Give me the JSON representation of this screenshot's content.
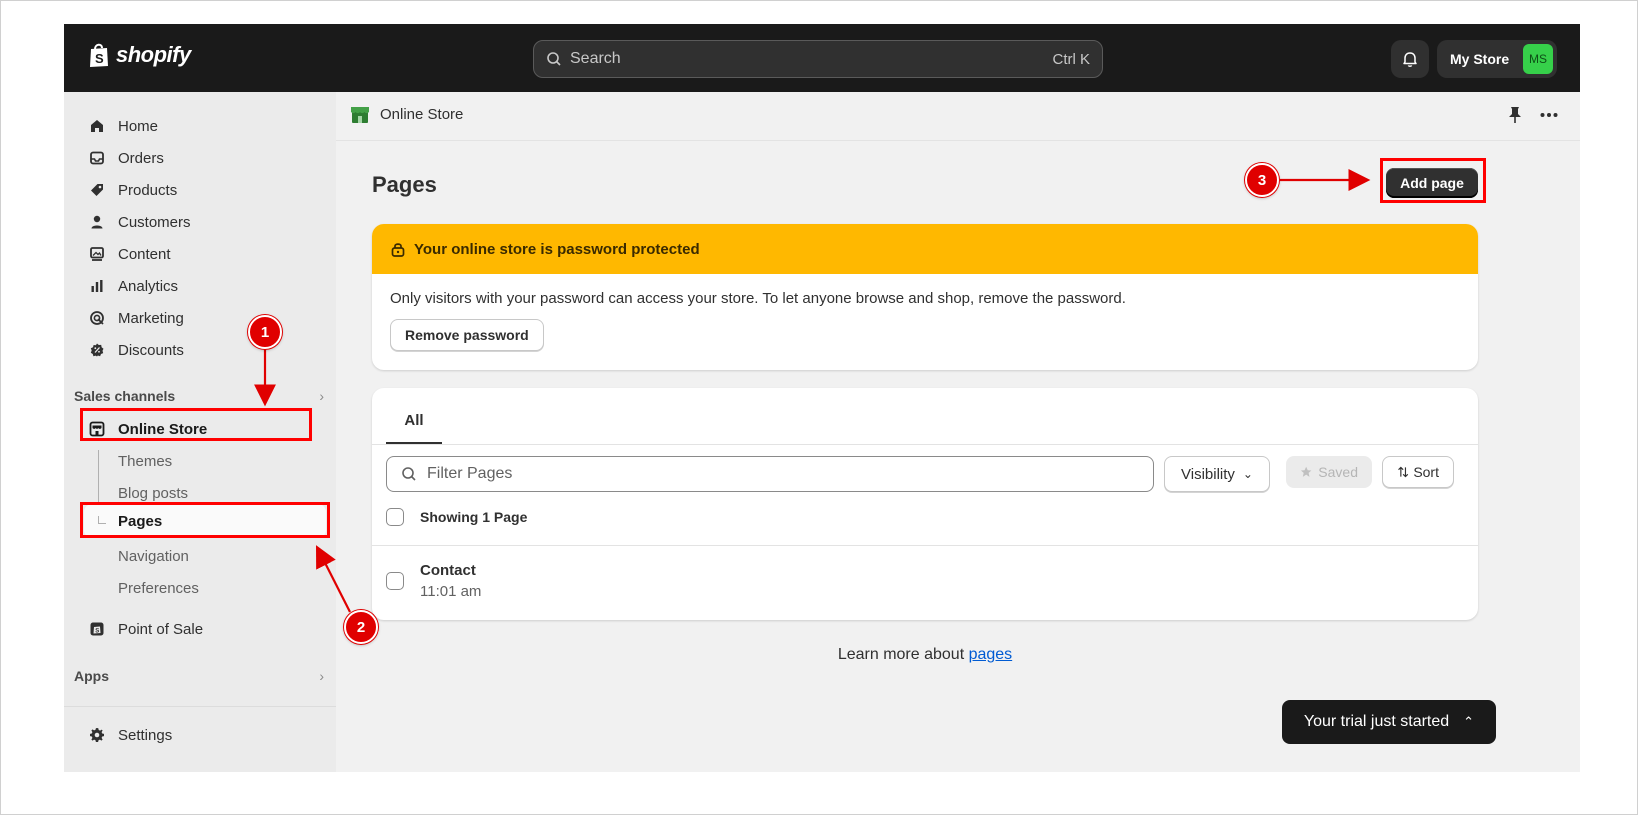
{
  "topbar": {
    "brand": "shopify",
    "search_placeholder": "Search",
    "search_shortcut": "Ctrl K",
    "store_name": "My Store",
    "avatar_initials": "MS"
  },
  "sidebar": {
    "items": [
      {
        "label": "Home",
        "icon": "home-icon"
      },
      {
        "label": "Orders",
        "icon": "inbox-icon"
      },
      {
        "label": "Products",
        "icon": "tag-icon"
      },
      {
        "label": "Customers",
        "icon": "person-icon"
      },
      {
        "label": "Content",
        "icon": "image-icon"
      },
      {
        "label": "Analytics",
        "icon": "bar-chart-icon"
      },
      {
        "label": "Marketing",
        "icon": "target-icon"
      },
      {
        "label": "Discounts",
        "icon": "discount-icon"
      }
    ],
    "sales_channels_label": "Sales channels",
    "online_store": "Online Store",
    "sub_items": [
      "Themes",
      "Blog posts",
      "Pages",
      "Navigation",
      "Preferences"
    ],
    "point_of_sale": "Point of Sale",
    "apps_label": "Apps",
    "settings": "Settings"
  },
  "main": {
    "breadcrumb": "Online Store",
    "page_title": "Pages",
    "add_button": "Add page",
    "banner": {
      "title": "Your online store is password protected",
      "body": "Only visitors with your password can access your store. To let anyone browse and shop, remove the password.",
      "button": "Remove password"
    },
    "list": {
      "tab_all": "All",
      "filter_placeholder": "Filter Pages",
      "visibility": "Visibility",
      "saved": "Saved",
      "sort": "Sort",
      "showing": "Showing 1 Page",
      "rows": [
        {
          "title": "Contact",
          "time": "11:01 am"
        }
      ]
    },
    "learn_prefix": "Learn more about ",
    "learn_link": "pages",
    "trial": "Your trial just started"
  },
  "annotations": [
    "1",
    "2",
    "3"
  ],
  "colors": {
    "topbar": "#1a1a1a",
    "banner": "#ffb800",
    "annotation": "#ff0000",
    "link": "#005bd3",
    "avatar": "#36d04a"
  }
}
